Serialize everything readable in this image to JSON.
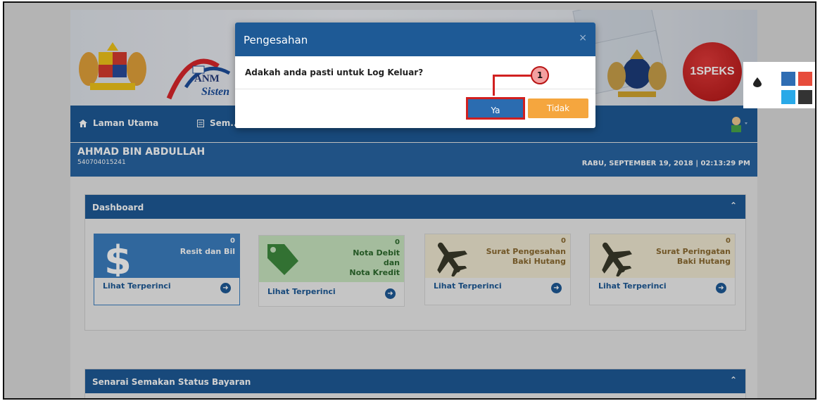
{
  "header": {
    "anm_text": "ANM",
    "sistem_text": "Sisten",
    "speks_text": "1SPEKS"
  },
  "navbar": {
    "home_label": "Laman Utama",
    "semakan_label": "Sem..."
  },
  "user": {
    "name": "AHMAD BIN ABDULLAH",
    "id": "540704015241",
    "datetime": "RABU, SEPTEMBER 19, 2018 | 02:13:29 PM"
  },
  "dashboard": {
    "title": "Dashboard",
    "cards": [
      {
        "count": "0",
        "title": "Resit dan Bil",
        "link": "Lihat Terperinci",
        "color": "#3b7ec0"
      },
      {
        "count": "0",
        "title_lines": [
          "Nota Debit",
          "dan",
          "Nota Kredit"
        ],
        "link": "Lihat Terperinci",
        "color": "#c8e6c0"
      },
      {
        "count": "0",
        "title_lines": [
          "Surat Pengesahan",
          "Baki Hutang"
        ],
        "link": "Lihat Terperinci",
        "color": "#f1ead2"
      },
      {
        "count": "0",
        "title_lines": [
          "Surat Peringatan",
          "Baki Hutang"
        ],
        "link": "Lihat Terperinci",
        "color": "#f1ead2"
      }
    ]
  },
  "panel2": {
    "title": "Senarai Semakan Status Bayaran"
  },
  "modal": {
    "title": "Pengesahan",
    "message": "Adakah anda pasti untuk Log Keluar?",
    "yes_label": "Ya",
    "no_label": "Tidak"
  },
  "callout": {
    "number": "1"
  },
  "theme": {
    "swatches": [
      "#2f6db3",
      "#e74c3c",
      "#29a9e8",
      "#333333"
    ]
  }
}
